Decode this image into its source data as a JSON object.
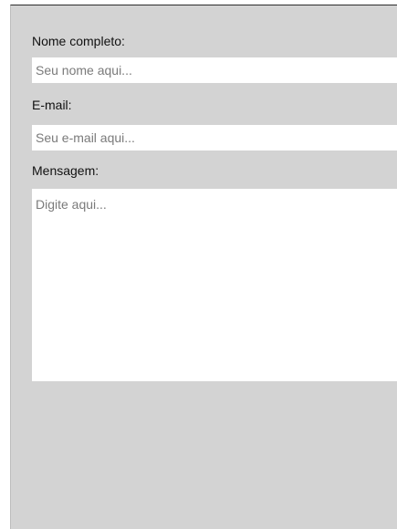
{
  "form": {
    "name_label": "Nome completo:",
    "name_placeholder": "Seu nome aqui...",
    "email_label": "E-mail:",
    "email_placeholder": "Seu e-mail aqui...",
    "message_label": "Mensagem:",
    "message_placeholder": "Digite aqui..."
  },
  "colors": {
    "panel_background": "#d3d3d3",
    "field_background": "#ffffff",
    "placeholder_text": "#7a7a7a",
    "label_text": "#111111"
  }
}
